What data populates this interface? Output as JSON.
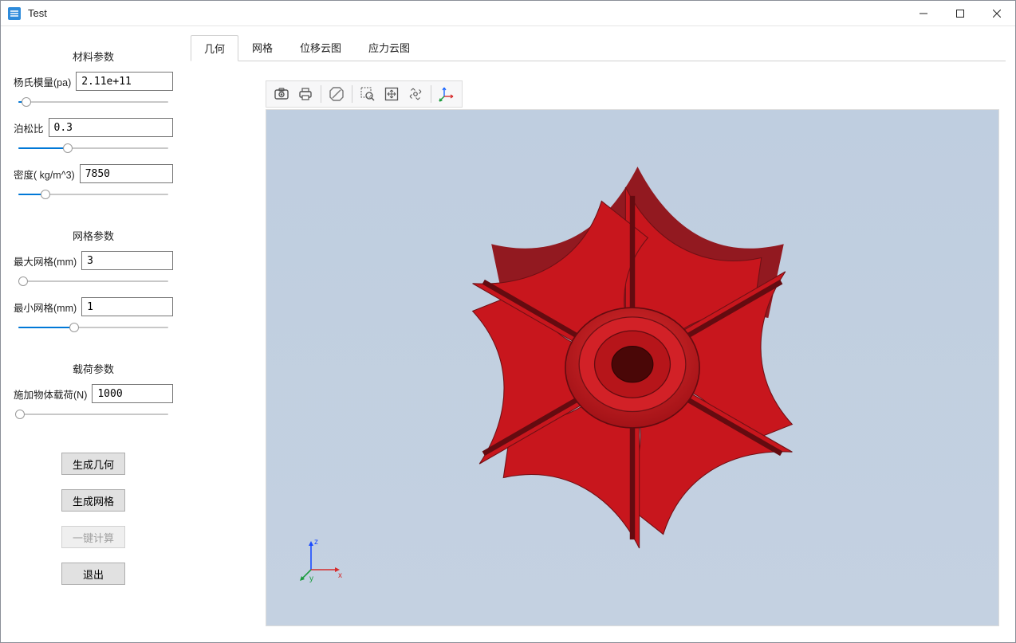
{
  "window": {
    "title": "Test"
  },
  "sidebar": {
    "material_section": "材料参数",
    "youngs_label": "杨氏模量(pa)",
    "youngs_value": "2.11e+11",
    "poisson_label": "泊松比",
    "poisson_value": "0.3",
    "density_label": "密度( kg/m^3)",
    "density_value": "7850",
    "mesh_section": "网格参数",
    "maxmesh_label": "最大网格(mm)",
    "maxmesh_value": "3",
    "minmesh_label": "最小网格(mm)",
    "minmesh_value": "1",
    "load_section": "载荷参数",
    "bodyload_label": "施加物体载荷(N)",
    "bodyload_value": "1000",
    "btn_geom": "生成几何",
    "btn_mesh": "生成网格",
    "btn_solve": "一键计算",
    "btn_exit": "退出"
  },
  "tabs": {
    "geom": "几何",
    "mesh": "网格",
    "disp": "位移云图",
    "stress": "应力云图"
  },
  "toolbar_icons": {
    "screenshot": "screenshot-icon",
    "print": "print-icon",
    "stop": "stop-icon",
    "zoom_window": "zoom-window-icon",
    "fit": "fit-view-icon",
    "rotate": "rotate-view-icon",
    "axes": "axes-icon"
  },
  "triad_labels": {
    "x": "x",
    "y": "y",
    "z": "z"
  },
  "colors": {
    "accent": "#0078d7",
    "model": "#c8161d",
    "model_dark": "#8f0f15",
    "viewport_bg_top": "#bfcee0"
  }
}
